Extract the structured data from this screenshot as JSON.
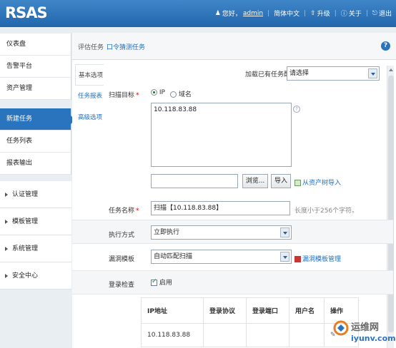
{
  "app": {
    "logo": "RSAS"
  },
  "topnav": {
    "greeting": "您好，",
    "user": "admin",
    "lang": "简体中文",
    "upgrade": "升级",
    "about": "关于",
    "logout": "退出"
  },
  "menu": {
    "top": [
      "仪表盘",
      "告警平台",
      "资产管理"
    ],
    "tasks": [
      {
        "label": "新建任务",
        "active": true
      },
      {
        "label": "任务列表",
        "active": false
      },
      {
        "label": "报表输出",
        "active": false
      }
    ],
    "groups": [
      "认证管理",
      "模板管理",
      "系统管理",
      "安全中心"
    ]
  },
  "tabs": [
    "评估任务",
    "口令猜测任务"
  ],
  "subtabs": [
    "基本选项",
    "任务报表",
    "高级选项"
  ],
  "form": {
    "load_config_label": "加载已有任务配置",
    "load_config_value": "请选择",
    "scan_target_label": "扫描目标",
    "target_type_ip": "IP",
    "target_type_domain": "域名",
    "targets_text": "10.118.83.88",
    "browse_button": "浏览...",
    "import_button": "导入",
    "import_from_assets": "从资产树导入",
    "task_name_label": "任务名称",
    "task_name_value": "扫描【10.118.83.88】",
    "task_name_hint": "长度小于256个字符。",
    "exec_mode_label": "执行方式",
    "exec_mode_value": "立即执行",
    "vuln_template_label": "漏洞模板",
    "vuln_template_value": "自动匹配扫描",
    "template_manage_link": "漏洞模板管理",
    "login_check_label": "登录检查",
    "login_check_enable": "启用",
    "table": {
      "headers": [
        "IP地址",
        "登录协议",
        "登录端口",
        "用户名",
        "操作"
      ],
      "rows": [
        [
          "10.118.83.88",
          "",
          "",
          "",
          ""
        ]
      ]
    }
  },
  "watermark": {
    "brand": "运维网",
    "site": "iyunv.com"
  },
  "colors": {
    "header": "#2a74bd",
    "link": "#1d6fc0",
    "required": "#dd0000"
  }
}
